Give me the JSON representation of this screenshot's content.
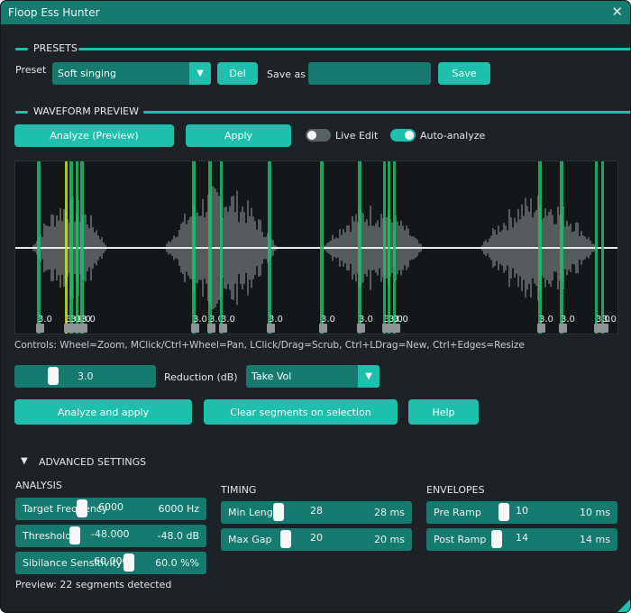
{
  "window": {
    "title": "Floop Ess Hunter",
    "close_glyph": "✕"
  },
  "presets": {
    "header": "PRESETS",
    "preset_label": "Preset",
    "selected": "Soft singing",
    "del_label": "Del",
    "save_as_label": "Save as",
    "save_as_value": "",
    "save_label": "Save"
  },
  "waveform": {
    "header": "WAVEFORM PREVIEW",
    "analyze_preview_label": "Analyze (Preview)",
    "apply_label": "Apply",
    "live_edit_label": "Live Edit",
    "live_edit_on": false,
    "auto_analyze_label": "Auto-analyze",
    "auto_analyze_on": true,
    "segment_value_label": "3.0",
    "controls_text": "Controls: Wheel=Zoom, MClick/Ctrl+Wheel=Pan, LClick/Drag=Scrub, Ctrl+LDrag=New, Ctrl+Edges=Resize"
  },
  "reduction": {
    "value": "3.0",
    "label": "Reduction (dB)",
    "mode": "Take Vol"
  },
  "actions": {
    "analyze_apply_label": "Analyze and apply",
    "clear_label": "Clear segments on selection",
    "help_label": "Help"
  },
  "advanced": {
    "header": "ADVANCED SETTINGS",
    "expander_glyph": "▼",
    "analysis": {
      "header": "ANALYSIS",
      "target_freq": {
        "name": "Target Frequency",
        "value": "6000",
        "display": "6000 Hz",
        "level": 0.27
      },
      "threshold": {
        "name": "Threshold",
        "value": "-48.000",
        "display": "-48.0 dB",
        "level": 0.27
      },
      "sibilance": {
        "name": "Sibilance Sensitivity",
        "value": "60.000",
        "display": "60.0 %%",
        "level": 0.6
      }
    },
    "timing": {
      "header": "TIMING",
      "min_length": {
        "name": "Min Length",
        "value": "28",
        "display": "28 ms",
        "level": 0.27
      },
      "max_gap": {
        "name": "Max Gap",
        "value": "20",
        "display": "20 ms",
        "level": 0.3
      }
    },
    "envelopes": {
      "header": "ENVELOPES",
      "pre_ramp": {
        "name": "Pre Ramp",
        "value": "10",
        "display": "10 ms",
        "level": 0.36
      },
      "post_ramp": {
        "name": "Post Ramp",
        "value": "14",
        "display": "14 ms",
        "level": 0.32
      }
    },
    "status": "Preview: 22 segments detected"
  },
  "colors": {
    "accent": "#1fbfae",
    "accent_dark": "#157a6f",
    "background": "#1d2226",
    "segment": "#1fbf6a",
    "segment_selected": "#c9e23c"
  }
}
